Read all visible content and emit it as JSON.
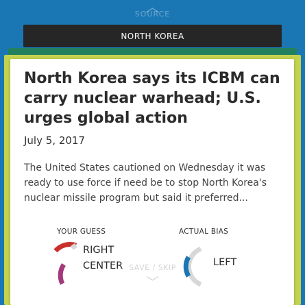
{
  "nav": {
    "top_label": "SOURCE",
    "bottom_label": "SAVE / SKIP"
  },
  "article": {
    "category": "NORTH KOREA",
    "headline": "North Korea says its ICBM can carry nuclear warhead; U.S. urges global action",
    "date": "July 5, 2017",
    "summary": "The United States cautioned on Wednesday it was ready to use force if need be to stop North Korea's nuclear missile program but said it preferred..."
  },
  "your_guess": {
    "label": "YOUR GUESS",
    "values": [
      "RIGHT",
      "CENTER"
    ]
  },
  "actual_bias": {
    "label": "ACTUAL BIAS",
    "value": "LEFT"
  },
  "colors": {
    "background": "#1b77b3",
    "badge": "#262626",
    "stack_green": "#23805e",
    "stack_yellow": "#c4d34f",
    "gauge_right": "#c9302c",
    "gauge_center": "#a23a7c",
    "gauge_left": "#1b77b3",
    "gauge_track": "#d8d8d8"
  },
  "icons": {
    "top": "chevron-up-icon",
    "bottom": "chevron-down-icon",
    "guess": "bias-gauge-icon",
    "actual": "bias-gauge-icon"
  }
}
